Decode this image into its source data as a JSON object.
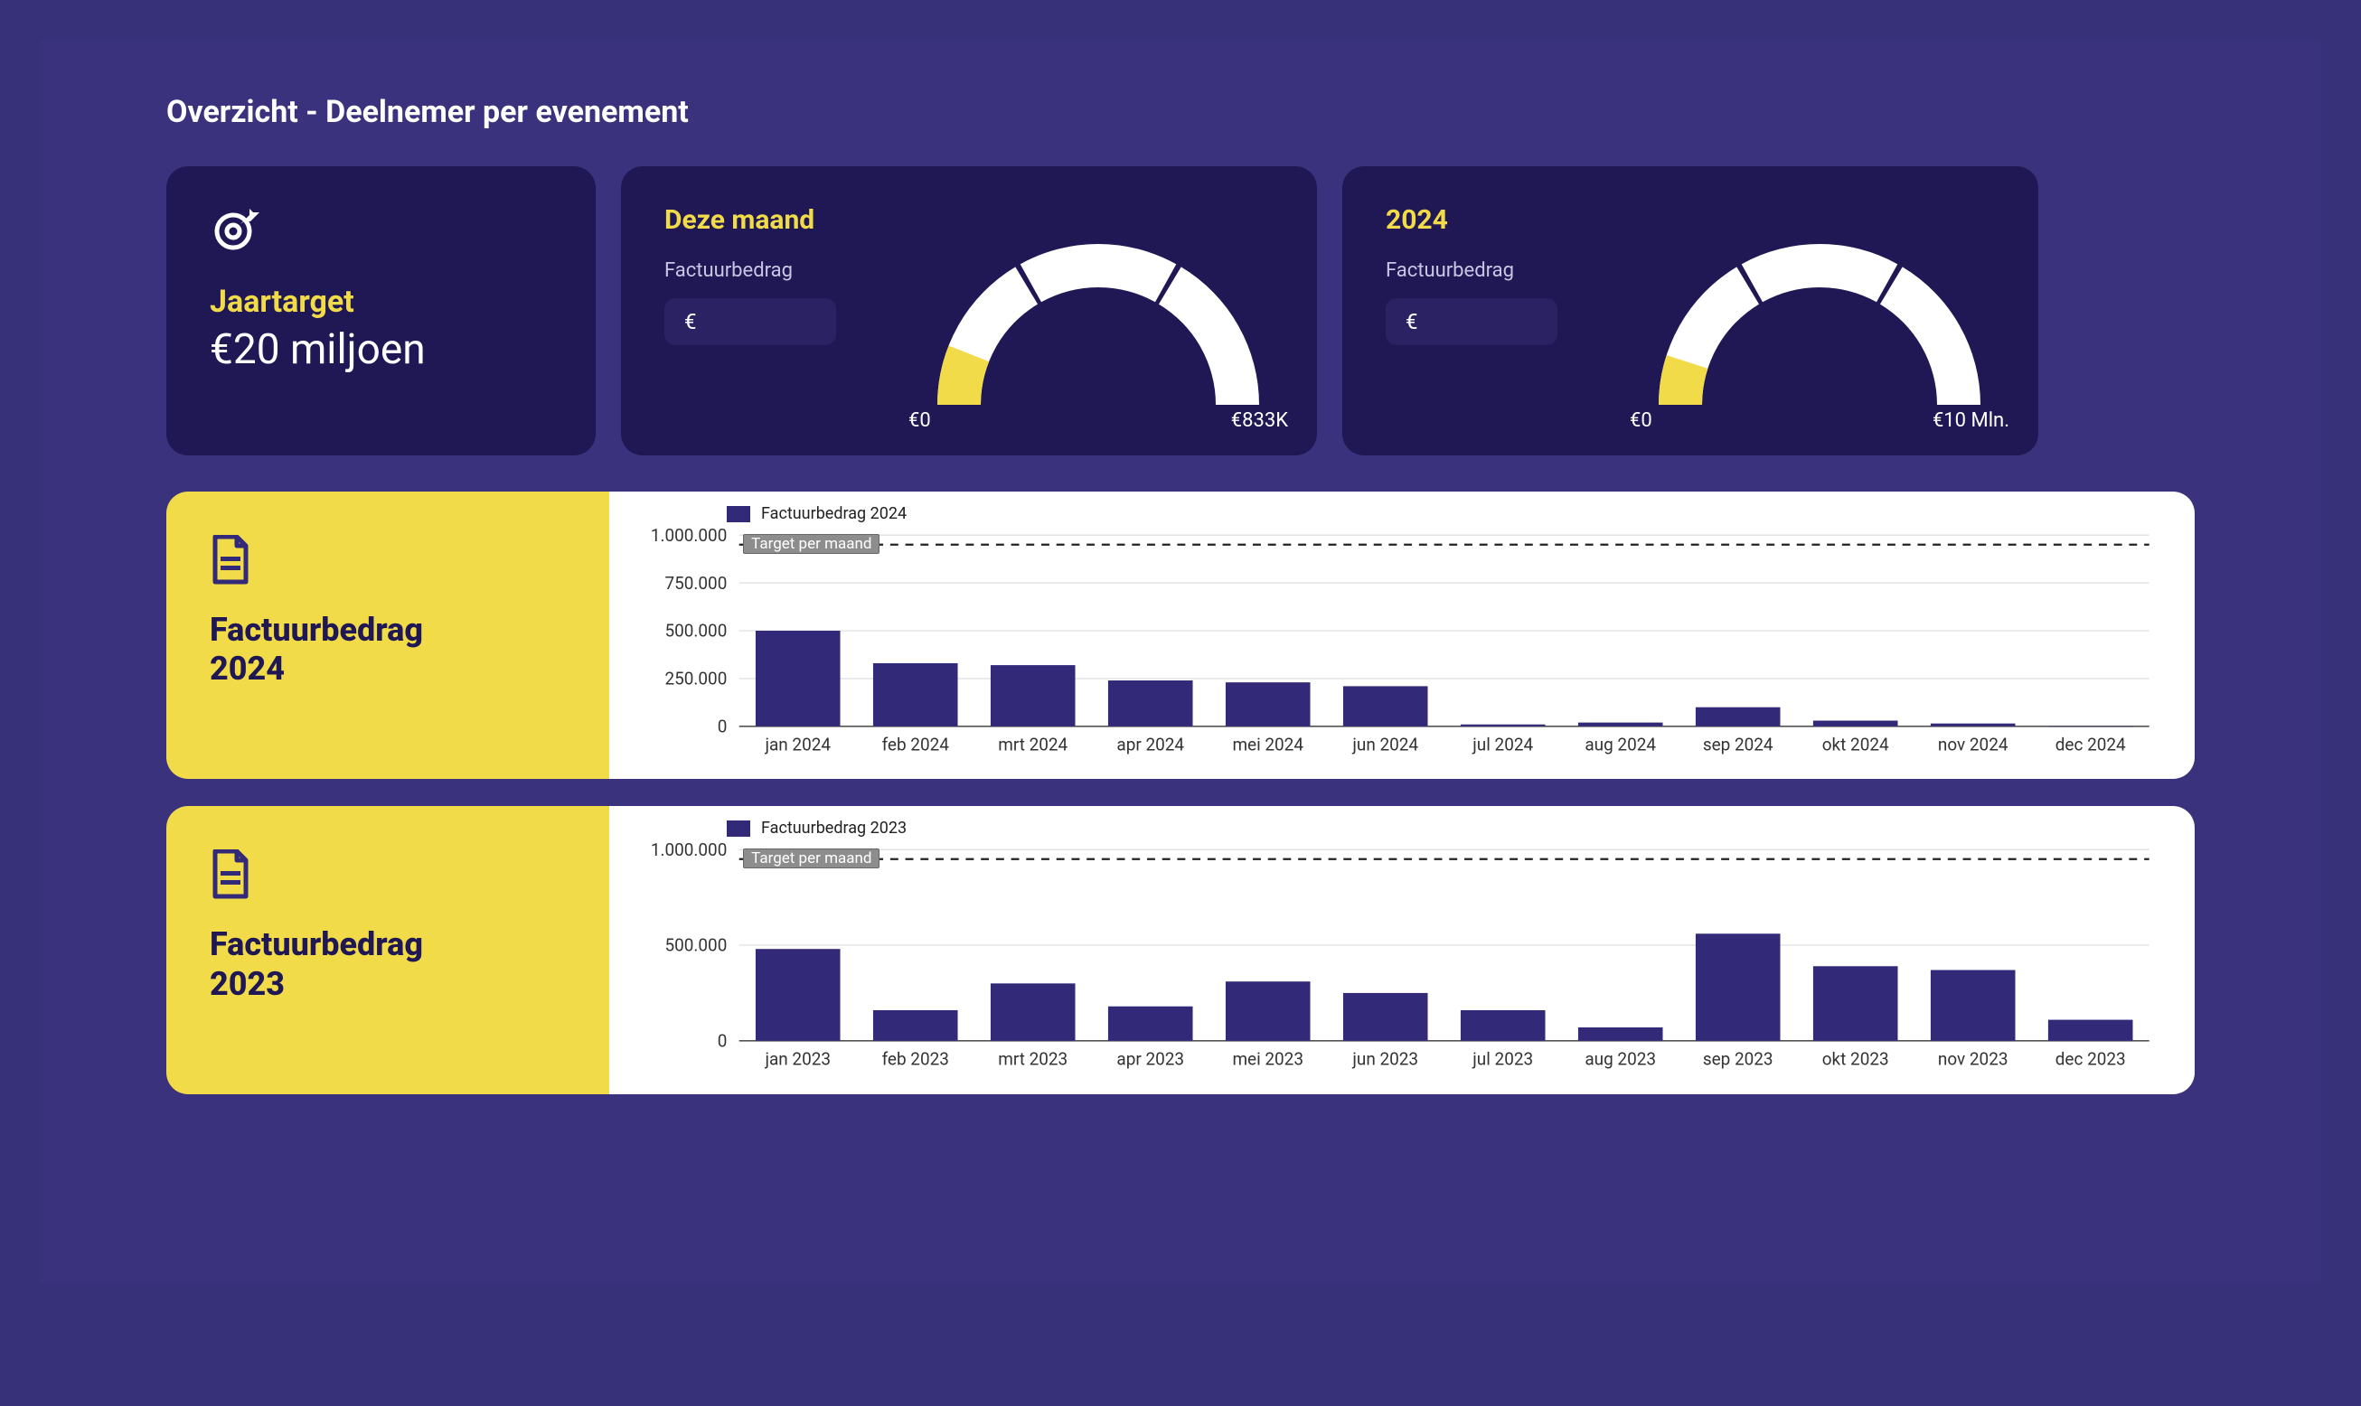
{
  "header": {
    "title": "Overzicht - Deelnemer per evenement"
  },
  "target_card": {
    "label": "Jaartarget",
    "value": "€20 miljoen"
  },
  "gauge_month": {
    "title": "Deze maand",
    "subtitle": "Factuurbedrag",
    "pill_value": "€",
    "min_label": "€0",
    "max_label": "€833K",
    "fill_fraction": 0.12
  },
  "gauge_year": {
    "title": "2024",
    "subtitle": "Factuurbedrag",
    "pill_value": "€",
    "min_label": "€0",
    "max_label": "€10 Mln.",
    "fill_fraction": 0.1
  },
  "chart_2024": {
    "panel_title": "Factuurbedrag\n2024",
    "legend": "Factuurbedrag 2024",
    "target_label": "Target per maand"
  },
  "chart_2023": {
    "panel_title": "Factuurbedrag\n2023",
    "legend": "Factuurbedrag 2023",
    "target_label": "Target per maand"
  },
  "chart_data": [
    {
      "id": "chart_2024",
      "type": "bar",
      "title": "Factuurbedrag 2024",
      "ylabel": "",
      "ylim": [
        0,
        1000000
      ],
      "yticks": [
        0,
        250000,
        500000,
        750000,
        1000000
      ],
      "categories": [
        "jan 2024",
        "feb 2024",
        "mrt 2024",
        "apr 2024",
        "mei 2024",
        "jun 2024",
        "jul 2024",
        "aug 2024",
        "sep 2024",
        "okt 2024",
        "nov 2024",
        "dec 2024"
      ],
      "series": [
        {
          "name": "Factuurbedrag 2024",
          "values": [
            500000,
            330000,
            320000,
            240000,
            230000,
            210000,
            10000,
            20000,
            100000,
            30000,
            15000,
            0
          ]
        }
      ],
      "reference_lines": [
        {
          "name": "Target per maand",
          "value": 950000,
          "style": "dashed"
        }
      ]
    },
    {
      "id": "chart_2023",
      "type": "bar",
      "title": "Factuurbedrag 2023",
      "ylabel": "",
      "ylim": [
        0,
        1000000
      ],
      "yticks": [
        0,
        500000,
        1000000
      ],
      "categories": [
        "jan 2023",
        "feb 2023",
        "mrt 2023",
        "apr 2023",
        "mei 2023",
        "jun 2023",
        "jul 2023",
        "aug 2023",
        "sep 2023",
        "okt 2023",
        "nov 2023",
        "dec 2023"
      ],
      "series": [
        {
          "name": "Factuurbedrag 2023",
          "values": [
            480000,
            160000,
            300000,
            180000,
            310000,
            250000,
            160000,
            70000,
            560000,
            390000,
            370000,
            110000
          ]
        }
      ],
      "reference_lines": [
        {
          "name": "Target per maand",
          "value": 950000,
          "style": "dashed"
        }
      ]
    }
  ]
}
